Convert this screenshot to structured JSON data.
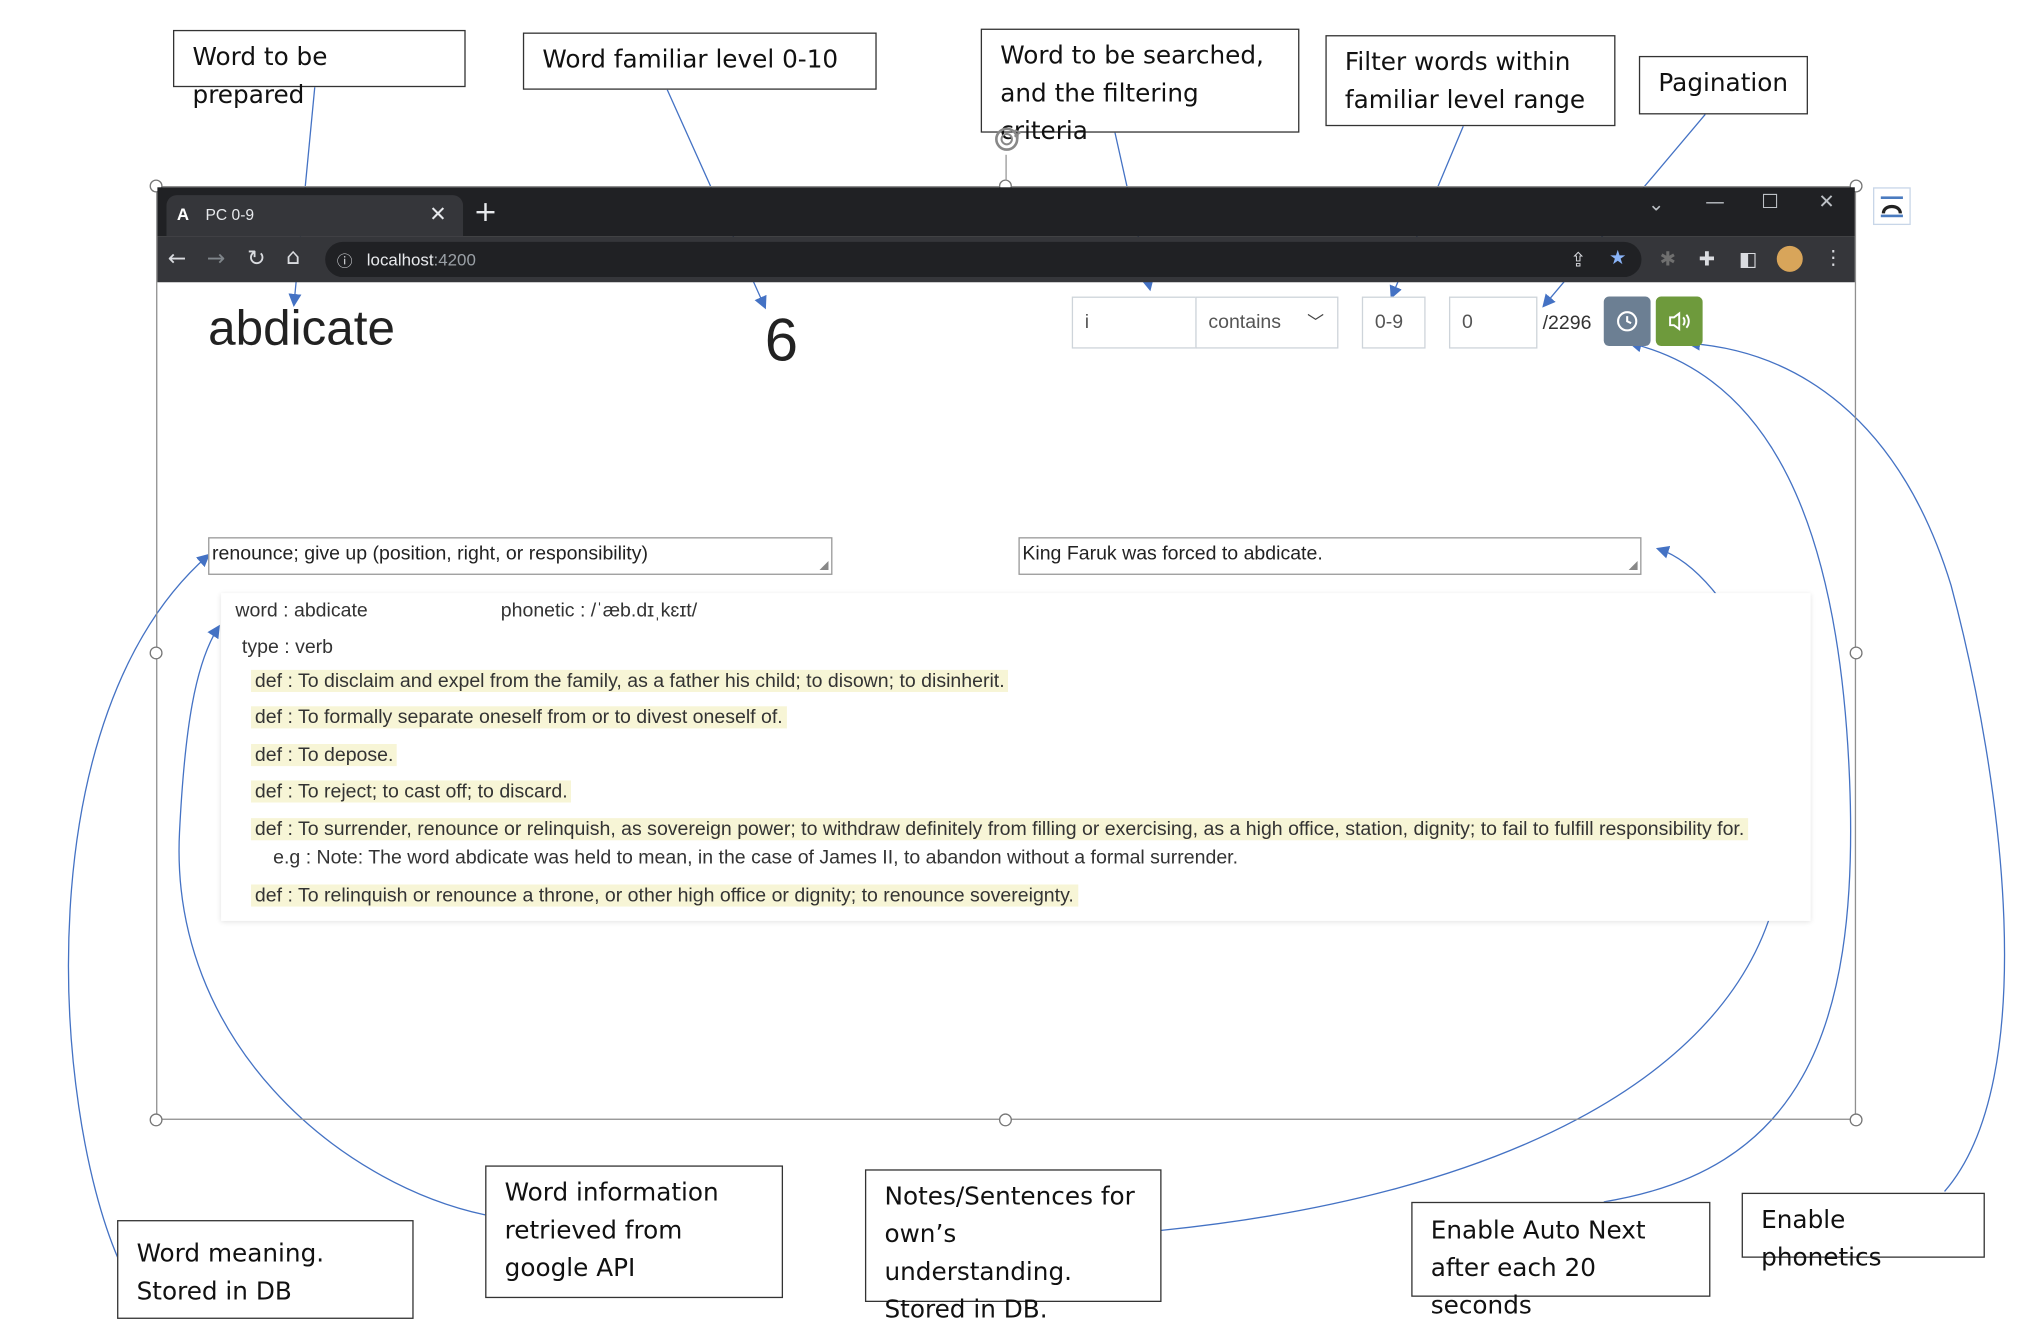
{
  "annotations": {
    "word_prepared": "Word to be prepared",
    "familiar_level": "Word familiar level 0-10",
    "search_criteria": "Word to be searched, and the filtering criteria",
    "filter_range": "Filter words within familiar level range",
    "pagination": "Pagination",
    "word_meaning": "Word meaning. Stored in DB",
    "word_info": "Word information retrieved from google API",
    "notes": "Notes/Sentences for own’s understanding. Stored in DB.",
    "auto_next": "Enable Auto Next after each 20 seconds",
    "phonetics": "Enable phonetics"
  },
  "browser": {
    "tab_title": "PC 0-9",
    "tab_favicon": "A",
    "url_host": "localhost",
    "url_port": ":4200"
  },
  "app": {
    "word": "abdicate",
    "familiar_level": "6",
    "search_value": "i",
    "filter_criteria": "contains",
    "level_range": "0-9",
    "page_number": "0",
    "page_total": "/2296",
    "meaning": "renounce; give up (position, right, or responsibility)",
    "notes": "King Faruk was forced to abdicate.",
    "accent_colors": {
      "auto_next": "#6c7f93",
      "phonetics": "#6e9a3c"
    }
  },
  "word_info": {
    "word_line": "word : abdicate",
    "phonetic_line": "phonetic : /ˈæb.dɪˌkɛɪt/",
    "type_line": "type : verb",
    "definitions": [
      "def : To disclaim and expel from the family, as a father his child; to disown; to disinherit.",
      "def : To formally separate oneself from or to divest oneself of.",
      "def : To depose.",
      "def : To reject; to cast off; to discard.",
      "def : To surrender, renounce or relinquish, as sovereign power; to withdraw definitely from filling or exercising, as a high office, station, dignity; to fail to fulfill responsibility for.",
      "def : To relinquish or renounce a throne, or other high office or dignity; to renounce sovereignty."
    ],
    "example": "e.g : Note: The word abdicate was held to mean, in the case of James II, to abandon without a formal surrender."
  },
  "icons": {
    "back": "arrow-left-icon",
    "forward": "arrow-right-icon",
    "reload": "reload-icon",
    "home": "home-icon",
    "auto_next": "clock-icon",
    "phonetics": "speaker-icon"
  }
}
